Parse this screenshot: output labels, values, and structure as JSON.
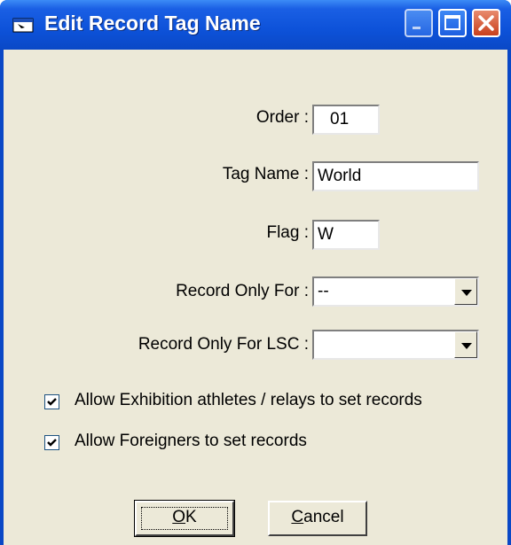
{
  "window": {
    "title": "Edit Record Tag Name"
  },
  "form": {
    "order": {
      "label": "Order :",
      "value": "01"
    },
    "tag_name": {
      "label": "Tag Name :",
      "value": "World"
    },
    "flag": {
      "label": "Flag :",
      "value": "W"
    },
    "record_only_for": {
      "label": "Record Only For :",
      "value": "--"
    },
    "record_only_for_lsc": {
      "label": "Record Only For LSC :",
      "value": ""
    }
  },
  "options": {
    "allow_exhibition": {
      "label": "Allow Exhibition athletes / relays to set records",
      "checked": true
    },
    "allow_foreigners": {
      "label": "Allow Foreigners to set records",
      "checked": true
    }
  },
  "buttons": {
    "ok_accel": "O",
    "ok_rest": "K",
    "cancel_accel": "C",
    "cancel_rest": "ancel"
  },
  "icons": {
    "window": "app-window-icon",
    "minimize": "minimize-icon",
    "maximize": "maximize-icon",
    "close": "close-icon",
    "dropdown": "chevron-down-icon",
    "check": "checkmark-icon"
  }
}
